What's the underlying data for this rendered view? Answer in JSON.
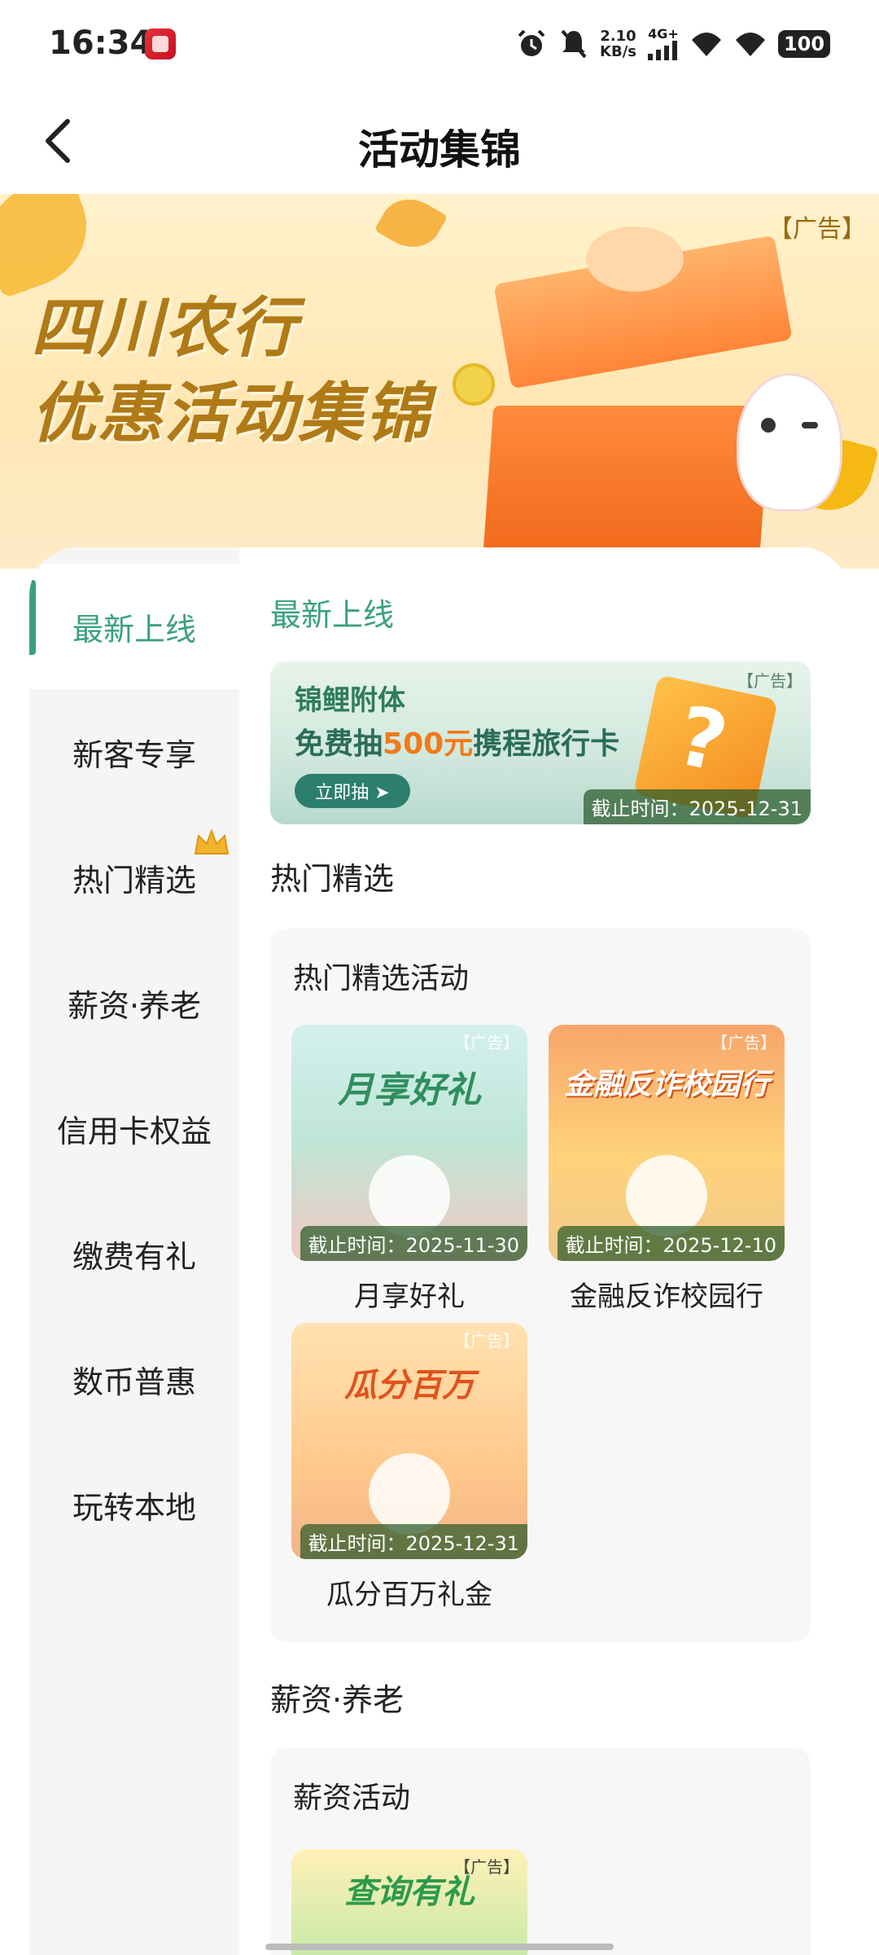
{
  "status_bar": {
    "time": "16:34",
    "net_speed_value": "2.10",
    "net_speed_unit": "KB/s",
    "network": "4G+",
    "battery": "100"
  },
  "header": {
    "title": "活动集锦",
    "back_icon": "back-arrow-icon"
  },
  "banner": {
    "title_line1": "四川农行",
    "title_line2": "优惠活动集锦",
    "ad_tag": "【广告】"
  },
  "sidebar": {
    "items": [
      {
        "label": "最新上线",
        "active": true
      },
      {
        "label": "新客专享",
        "active": false
      },
      {
        "label": "热门精选",
        "active": false,
        "badge_icon": "crown-icon"
      },
      {
        "label": "薪资·养老",
        "active": false
      },
      {
        "label": "信用卡权益",
        "active": false
      },
      {
        "label": "缴费有礼",
        "active": false
      },
      {
        "label": "数币普惠",
        "active": false
      },
      {
        "label": "玩转本地",
        "active": false
      }
    ]
  },
  "main": {
    "latest": {
      "section_title": "最新上线",
      "promo": {
        "ad_tag": "【广告】",
        "line1": "锦鲤附体",
        "line2_prefix": "免费抽",
        "line2_highlight": "500元",
        "line2_suffix": "携程旅行卡",
        "cta": "立即抽 ➤",
        "deadline": "截止时间：2025-12-31"
      }
    },
    "hot": {
      "section_title": "热门精选",
      "panel_title": "热门精选活动",
      "tiles": [
        {
          "headline": "月享好礼",
          "ad_tag": "【广告】",
          "deadline": "截止时间：2025-11-30",
          "label": "月享好礼"
        },
        {
          "headline": "金融反诈校园行",
          "ad_tag": "【广告】",
          "deadline": "截止时间：2025-12-10",
          "label": "金融反诈校园行"
        },
        {
          "headline": "瓜分百万",
          "ad_tag": "【广告】",
          "deadline": "截止时间：2025-12-31",
          "label": "瓜分百万礼金"
        }
      ]
    },
    "salary": {
      "section_title": "薪资·养老",
      "panel_title": "薪资活动",
      "tiles": [
        {
          "headline": "查询有礼",
          "ad_tag": "【广告】"
        }
      ]
    }
  },
  "colors": {
    "accent": "#3aa17b",
    "sidebar_bg": "#f5f5f5",
    "banner_text": "#b07a17"
  }
}
